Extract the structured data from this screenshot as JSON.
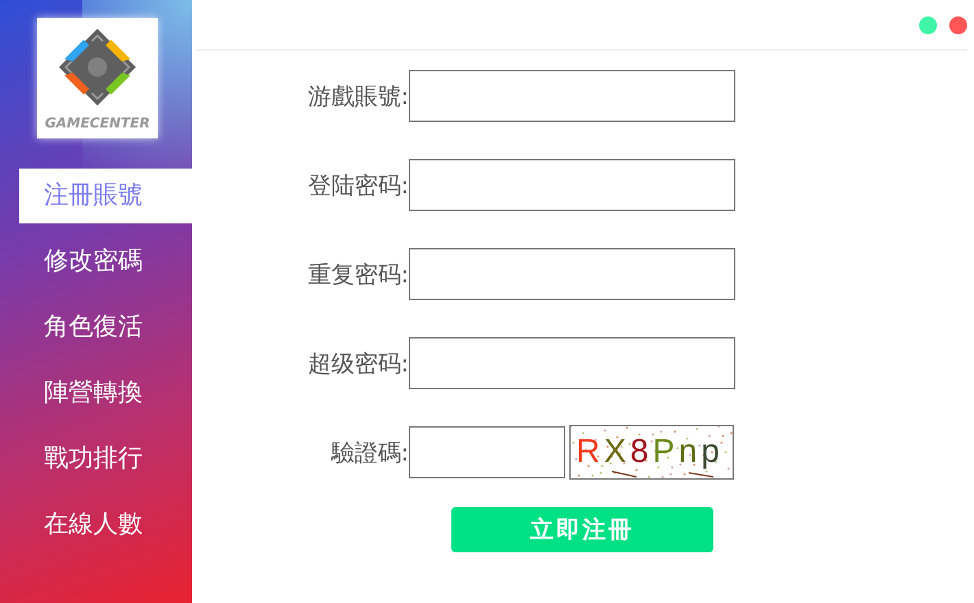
{
  "window": {
    "controls": [
      {
        "color": "#3ef5a8"
      },
      {
        "color": "#ff5757"
      }
    ]
  },
  "sidebar": {
    "logo_text": "GAMECENTER",
    "items": [
      {
        "label": "注冊賬號",
        "selected": true
      },
      {
        "label": "修改密碼",
        "selected": false
      },
      {
        "label": "角色復活",
        "selected": false
      },
      {
        "label": "陣營轉換",
        "selected": false
      },
      {
        "label": "戰功排行",
        "selected": false
      },
      {
        "label": "在線人數",
        "selected": false
      }
    ]
  },
  "form": {
    "fields": [
      {
        "kind": "text",
        "label": "游戲賬號:"
      },
      {
        "kind": "text",
        "label": "登陆密码:"
      },
      {
        "kind": "text",
        "label": "重复密码:"
      },
      {
        "kind": "text",
        "label": "超级密码:"
      },
      {
        "kind": "captcha",
        "label": "驗證碼:",
        "captcha": "RX8Pnp"
      }
    ],
    "submit": "立即注冊"
  }
}
